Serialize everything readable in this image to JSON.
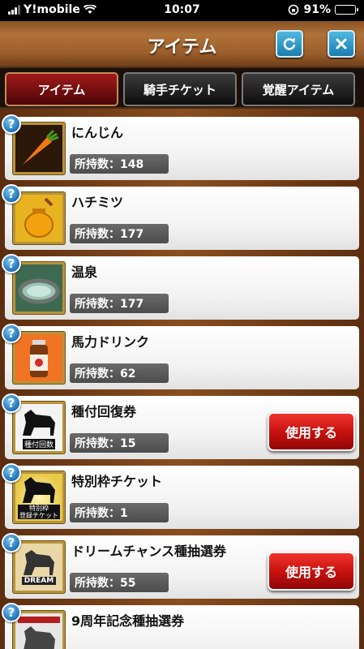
{
  "status_bar": {
    "carrier": "Y!mobile",
    "time": "10:07",
    "battery_percent": "91%",
    "battery_level": 0.91
  },
  "header": {
    "title": "アイテム",
    "refresh_icon": "refresh-icon",
    "close_icon": "close-icon",
    "accent_color": "#1a7db0"
  },
  "tabs": [
    {
      "label": "アイテム",
      "active": true
    },
    {
      "label": "騎手チケット",
      "active": false
    },
    {
      "label": "覚醒アイテム",
      "active": false
    }
  ],
  "items": [
    {
      "name": "にんじん",
      "quantity": "所持数：148",
      "icon": "carrot-icon",
      "use_label": ""
    },
    {
      "name": "ハチミツ",
      "quantity": "所持数：177",
      "icon": "honey-icon",
      "use_label": ""
    },
    {
      "name": "温泉",
      "quantity": "所持数：177",
      "icon": "hot-spring-icon",
      "use_label": ""
    },
    {
      "name": "馬力ドリンク",
      "quantity": "所持数：62",
      "icon": "energy-drink-icon",
      "use_label": ""
    },
    {
      "name": "種付回復券",
      "quantity": "所持数：15",
      "icon": "breeding-recovery-ticket-icon",
      "icon_text": "種付回数",
      "use_label": "使用する"
    },
    {
      "name": "特別枠チケット",
      "quantity": "所持数：1",
      "icon": "special-slot-ticket-icon",
      "icon_text": "特別枠\n登録チケット",
      "use_label": ""
    },
    {
      "name": "ドリームチャンス種抽選券",
      "quantity": "所持数：55",
      "icon": "dream-lottery-ticket-icon",
      "icon_text": "DREAM",
      "use_label": "使用する"
    },
    {
      "name": "9周年記念種抽選券",
      "quantity": "",
      "icon": "anniversary-lottery-ticket-icon",
      "use_label": ""
    }
  ],
  "help_glyph": "?",
  "colors": {
    "use_button": "#c4100e",
    "active_tab": "#a11a1a"
  }
}
